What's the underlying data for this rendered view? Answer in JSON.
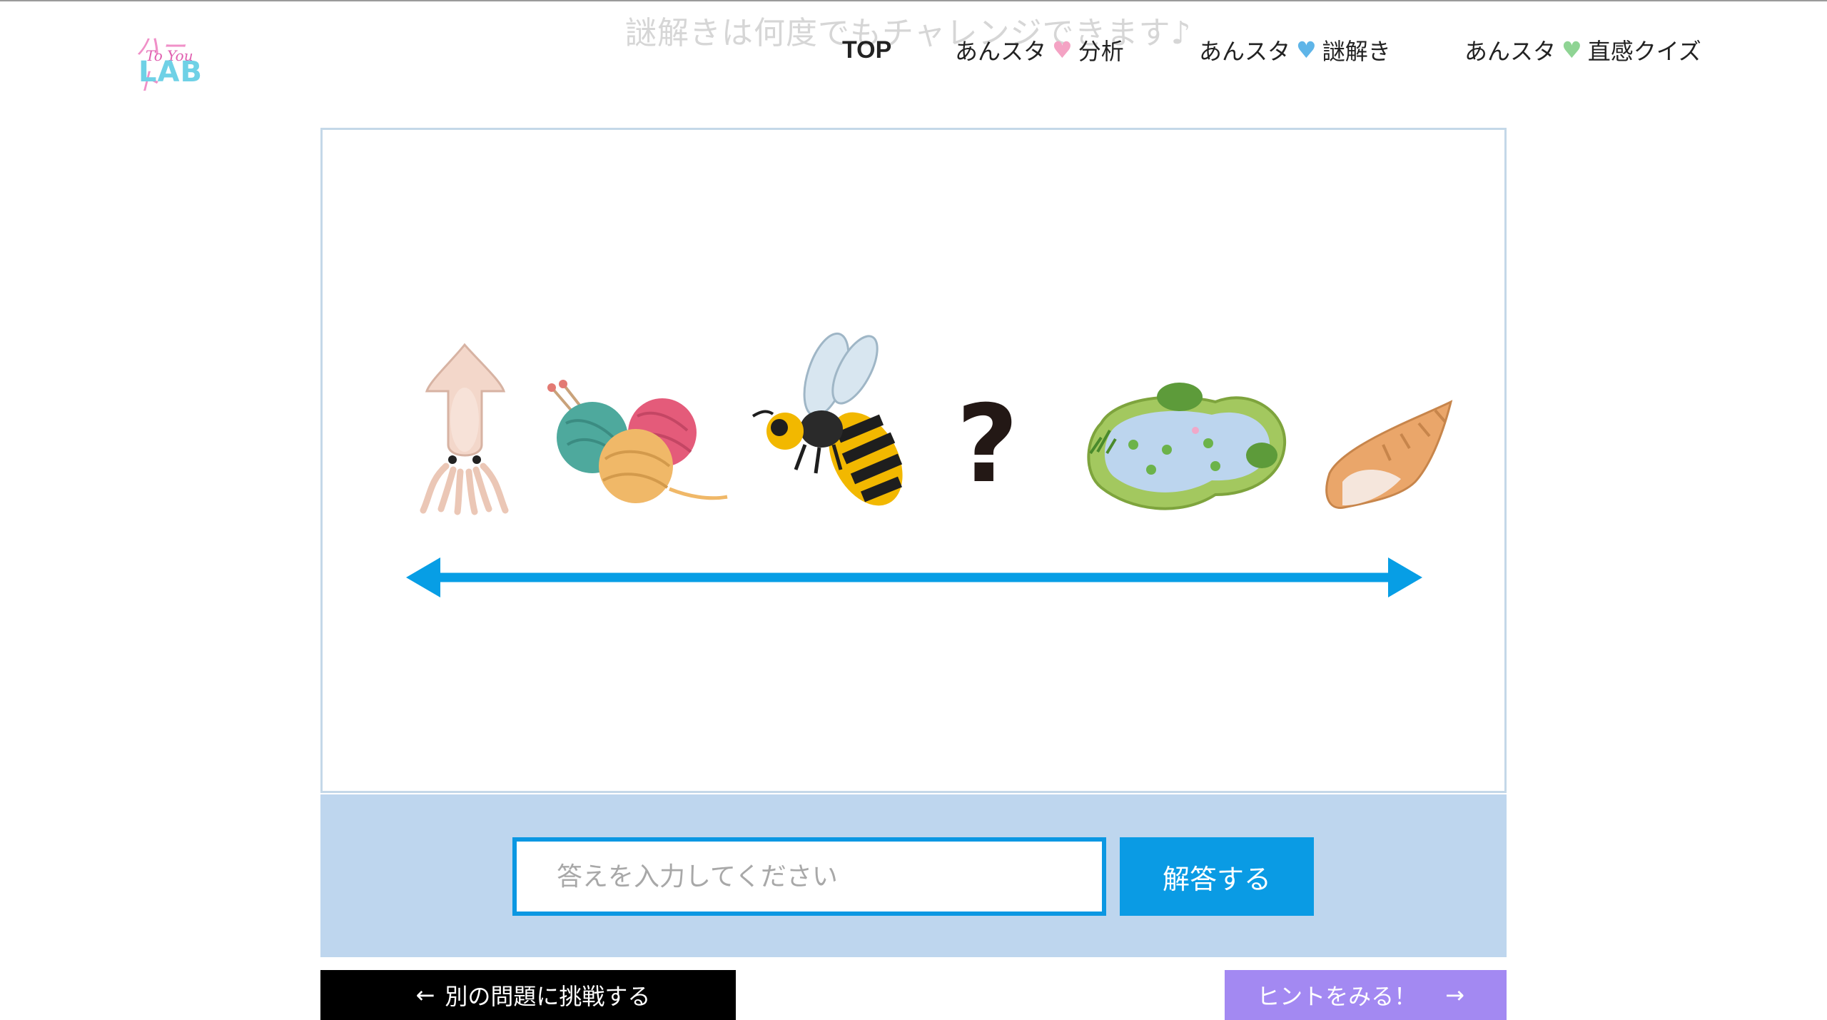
{
  "header": {
    "logo": {
      "line1": "ハート",
      "line2": "To You",
      "line3": "LAB"
    },
    "watermark": "謎解きは何度でもチャレンジできます♪",
    "nav": [
      {
        "label": "TOP"
      },
      {
        "prefix": "あんスタ",
        "heart": "♥",
        "suffix": "分析",
        "heart_color": "#f4a3c4"
      },
      {
        "prefix": "あんスタ",
        "heart": "♥",
        "suffix": "謎解き",
        "heart_color": "#5fb5e8"
      },
      {
        "prefix": "あんスタ",
        "heart": "♥",
        "suffix": "直感クイズ",
        "heart_color": "#8fd494"
      }
    ]
  },
  "puzzle": {
    "items": [
      "squid-icon",
      "yarn-balls-icon",
      "bee-icon",
      "question-mark",
      "pond-icon",
      "conch-shell-icon"
    ],
    "question_mark": "?",
    "arrow_color": "#079ee5"
  },
  "answer": {
    "placeholder": "答えを入力してください",
    "value": "",
    "submit_label": "解答する"
  },
  "footer": {
    "other_problem": {
      "arrow": "←",
      "label": "別の問題に挑戦する"
    },
    "hint": {
      "label": "ヒントをみる！",
      "arrow": "→"
    }
  },
  "colors": {
    "accent": "#0b97e2",
    "panel": "#bed6ee",
    "hint": "#a389f2"
  }
}
